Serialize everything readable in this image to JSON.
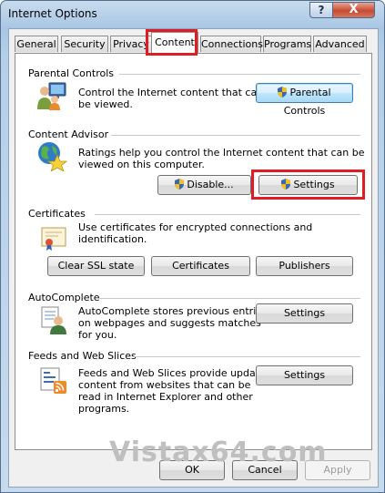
{
  "window": {
    "title": "Internet Options",
    "help_glyph": "?",
    "close_glyph": "X"
  },
  "tabs": [
    "General",
    "Security",
    "Privacy",
    "Content",
    "Connections",
    "Programs",
    "Advanced"
  ],
  "active_tab": "Content",
  "highlight_color": "#e01c24",
  "sections": {
    "parental_controls": {
      "heading": "Parental Controls",
      "description": [
        "Control the Internet content that can",
        "be viewed."
      ],
      "button": "Parental Controls",
      "icon": "parental-controls-icon"
    },
    "content_advisor": {
      "heading": "Content Advisor",
      "description": [
        "Ratings help you control the Internet content that can be",
        "viewed on this computer."
      ],
      "disable_button": "Disable...",
      "settings_button": "Settings",
      "icon": "content-advisor-icon"
    },
    "certificates": {
      "heading": "Certificates",
      "description": [
        "Use certificates for encrypted connections and identification."
      ],
      "buttons": [
        "Clear SSL state",
        "Certificates",
        "Publishers"
      ],
      "icon": "certificate-icon"
    },
    "autocomplete": {
      "heading": "AutoComplete",
      "description": [
        "AutoComplete stores previous entries",
        "on webpages and suggests matches",
        "for you."
      ],
      "button": "Settings",
      "icon": "autocomplete-icon"
    },
    "feeds": {
      "heading": "Feeds and Web Slices",
      "description": [
        "Feeds and Web Slices provide updated",
        "content from websites that can be",
        "read in Internet Explorer and other",
        "programs."
      ],
      "button": "Settings",
      "icon": "feeds-icon"
    }
  },
  "footer": {
    "ok": "OK",
    "cancel": "Cancel",
    "apply": "Apply",
    "apply_enabled": false
  },
  "watermark": "Vistax64.com"
}
